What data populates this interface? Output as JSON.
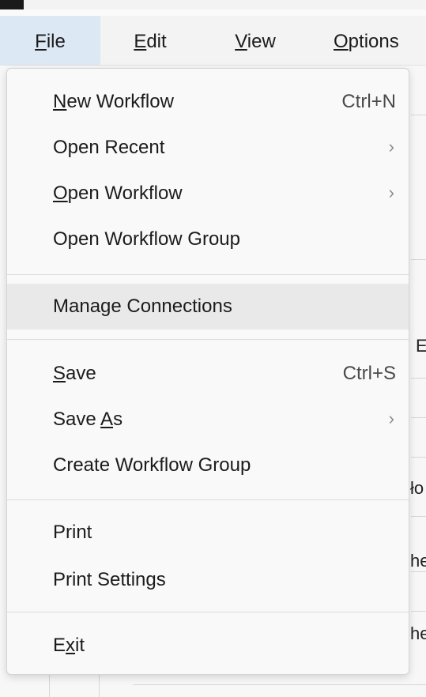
{
  "menubar": {
    "items": [
      {
        "label": "File",
        "mnemonic": "F",
        "rest": "ile"
      },
      {
        "label": "Edit",
        "mnemonic": "E",
        "rest": "dit"
      },
      {
        "label": "View",
        "mnemonic": "V",
        "rest": "iew"
      },
      {
        "label": "Options",
        "mnemonic": "O",
        "rest": "ptions"
      }
    ]
  },
  "background": {
    "fragments": [
      "E",
      "ło",
      "he",
      "he"
    ]
  },
  "file_menu": {
    "items": [
      {
        "pre": "",
        "mnemonic": "N",
        "post": "ew Workflow",
        "shortcut": "Ctrl+N",
        "arrow": ""
      },
      {
        "pre": "Open Recent",
        "mnemonic": "",
        "post": "",
        "shortcut": "",
        "arrow": "›"
      },
      {
        "pre": "",
        "mnemonic": "O",
        "post": "pen Workflow",
        "shortcut": "",
        "arrow": "›"
      },
      {
        "pre": "Open Workflow Group",
        "mnemonic": "",
        "post": "",
        "shortcut": "",
        "arrow": ""
      },
      {
        "pre": "Manage Connections",
        "mnemonic": "",
        "post": "",
        "shortcut": "",
        "arrow": ""
      },
      {
        "pre": "",
        "mnemonic": "S",
        "post": "ave",
        "shortcut": "Ctrl+S",
        "arrow": ""
      },
      {
        "pre": "Save ",
        "mnemonic": "A",
        "post": "s",
        "shortcut": "",
        "arrow": "›"
      },
      {
        "pre": "Create Workflow Group",
        "mnemonic": "",
        "post": "",
        "shortcut": "",
        "arrow": ""
      },
      {
        "pre": "Print",
        "mnemonic": "",
        "post": "",
        "shortcut": "",
        "arrow": ""
      },
      {
        "pre": "Print Settings",
        "mnemonic": "",
        "post": "",
        "shortcut": "",
        "arrow": ""
      },
      {
        "pre": "E",
        "mnemonic": "x",
        "post": "it",
        "shortcut": "",
        "arrow": ""
      }
    ]
  }
}
